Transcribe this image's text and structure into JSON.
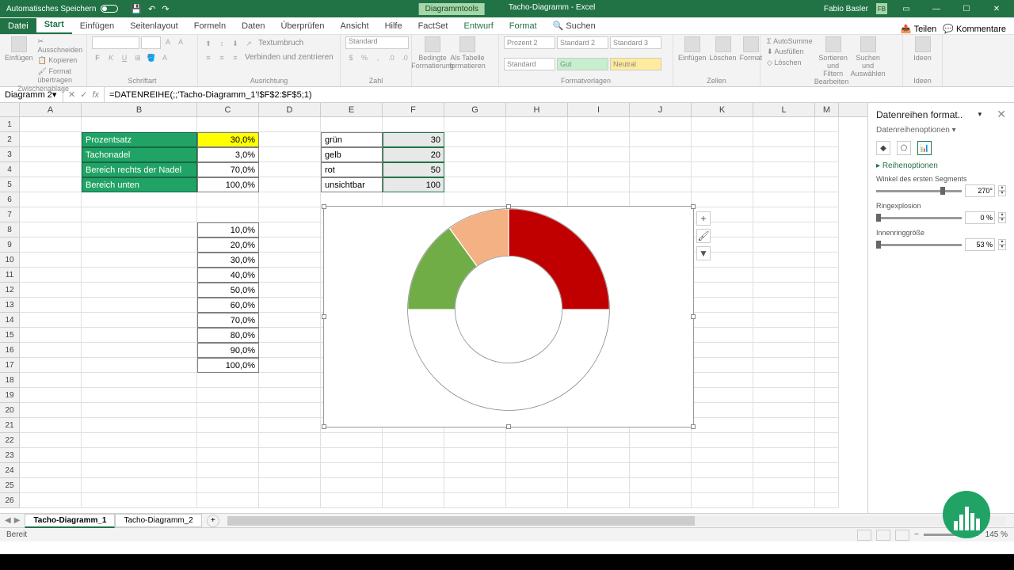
{
  "app": {
    "autosave": "Automatisches Speichern",
    "tool_context": "Diagrammtools",
    "doc_title": "Tacho-Diagramm - Excel",
    "user": "Fabio Basler",
    "user_initials": "FB"
  },
  "tabs": {
    "file": "Datei",
    "start": "Start",
    "einfuegen": "Einfügen",
    "seitenlayout": "Seitenlayout",
    "formeln": "Formeln",
    "daten": "Daten",
    "ueberpruefen": "Überprüfen",
    "ansicht": "Ansicht",
    "hilfe": "Hilfe",
    "factset": "FactSet",
    "entwurf": "Entwurf",
    "format": "Format",
    "suchen": "Suchen",
    "teilen": "Teilen",
    "kommentare": "Kommentare"
  },
  "ribbon": {
    "ausschneiden": "Ausschneiden",
    "kopieren": "Kopieren",
    "formatuebertragen": "Format übertragen",
    "zwischenablage": "Zwischenablage",
    "schriftart": "Schriftart",
    "ausrichtung": "Ausrichtung",
    "zahl": "Zahl",
    "standard": "Standard",
    "textumbruch": "Textumbruch",
    "verbinden": "Verbinden und zentrieren",
    "bedingte": "Bedingte Formatierung",
    "alsTabelle": "Als Tabelle formatieren",
    "prozent2": "Prozent 2",
    "standard2": "Standard 2",
    "standard3": "Standard 3",
    "standardStyle": "Standard",
    "gut": "Gut",
    "neutral": "Neutral",
    "formatvorlagen": "Formatvorlagen",
    "einfuegenBtn": "Einfügen",
    "loeschen": "Löschen",
    "formatBtn": "Format",
    "zellen": "Zellen",
    "autosumme": "AutoSumme",
    "ausfuellen": "Ausfüllen",
    "loeschen2": "Löschen",
    "sortieren": "Sortieren und Filtern",
    "suchen": "Suchen und Auswählen",
    "bearbeiten": "Bearbeiten",
    "ideen": "Ideen"
  },
  "namebox": "Diagramm 2",
  "formula": "=DATENREIHE(;;'Tacho-Diagramm_1'!$F$2:$F$5;1)",
  "columns": [
    "A",
    "B",
    "C",
    "D",
    "E",
    "F",
    "G",
    "H",
    "I",
    "J",
    "K",
    "L",
    "M"
  ],
  "table1": {
    "rows": [
      {
        "label": "Prozentsatz",
        "val": "30,0%",
        "yellow": true
      },
      {
        "label": "Tachonadel",
        "val": "3,0%"
      },
      {
        "label": "Bereich rechts der Nadel",
        "val": "70,0%"
      },
      {
        "label": "Bereich unten",
        "val": "100,0%"
      }
    ]
  },
  "table2": {
    "rows": [
      {
        "label": "grün",
        "val": "30"
      },
      {
        "label": "gelb",
        "val": "20"
      },
      {
        "label": "rot",
        "val": "50"
      },
      {
        "label": "unsichtbar",
        "val": "100"
      }
    ]
  },
  "table3": [
    "10,0%",
    "20,0%",
    "30,0%",
    "40,0%",
    "50,0%",
    "60,0%",
    "70,0%",
    "80,0%",
    "90,0%",
    "100,0%"
  ],
  "panel": {
    "title": "Datenreihen format..",
    "options": "Datenreihenoptionen",
    "section": "Reihenoptionen",
    "angle_label": "Winkel des ersten Segments",
    "angle_val": "270°",
    "explosion_label": "Ringexplosion",
    "explosion_val": "0 %",
    "inner_label": "Innenringgröße",
    "inner_val": "53 %"
  },
  "sheets": {
    "s1": "Tacho-Diagramm_1",
    "s2": "Tacho-Diagramm_2"
  },
  "status": {
    "ready": "Bereit",
    "zoom": "145 %"
  },
  "chart_data": {
    "type": "pie",
    "variant": "doughnut",
    "categories": [
      "grün",
      "gelb",
      "rot",
      "unsichtbar"
    ],
    "values": [
      30,
      20,
      50,
      100
    ],
    "colors": [
      "#70ad47",
      "#f4b183",
      "#c00000",
      "transparent"
    ],
    "first_slice_angle_deg": 270,
    "hole_size_pct": 53,
    "title": ""
  }
}
